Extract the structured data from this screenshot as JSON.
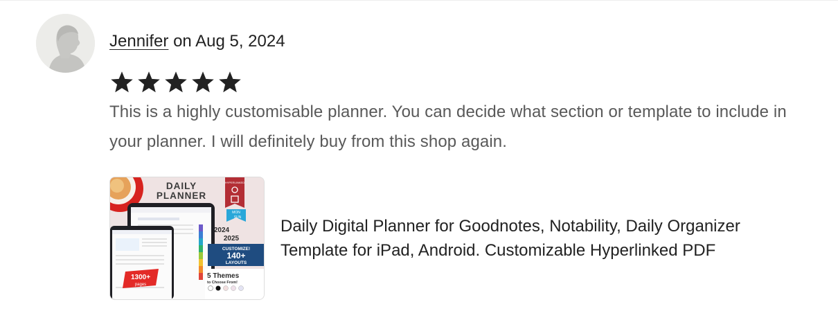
{
  "review": {
    "reviewer_name": "Jennifer",
    "date_text": "on Aug 5, 2024",
    "rating": 5,
    "rating_max": 5,
    "star_color": "#222222",
    "text": "This is a highly customisable planner. You can decide what section or template to include in your planner. I will definitely buy from this shop again."
  },
  "listing": {
    "title": "Daily Digital Planner for Goodnotes, Notability, Daily Organizer Template for iPad, Android. Customizable Hyperlinked PDF",
    "thumbnail": {
      "heading_line1": "DAILY",
      "heading_line2": "PLANNER",
      "badge_top": "HYPERLINKED",
      "badge_bottom_line1": "MON",
      "badge_bottom_line2": "SUN",
      "years_line1": "2024",
      "years_line2": "2025",
      "customize_line1": "CUSTOMIZE!",
      "customize_line2": "140+",
      "customize_line3": "LAYOUTS",
      "themes_line1": "5 Themes",
      "themes_line2": "to Choose From!",
      "pages_line1": "1300+",
      "pages_line2": "pages"
    }
  }
}
